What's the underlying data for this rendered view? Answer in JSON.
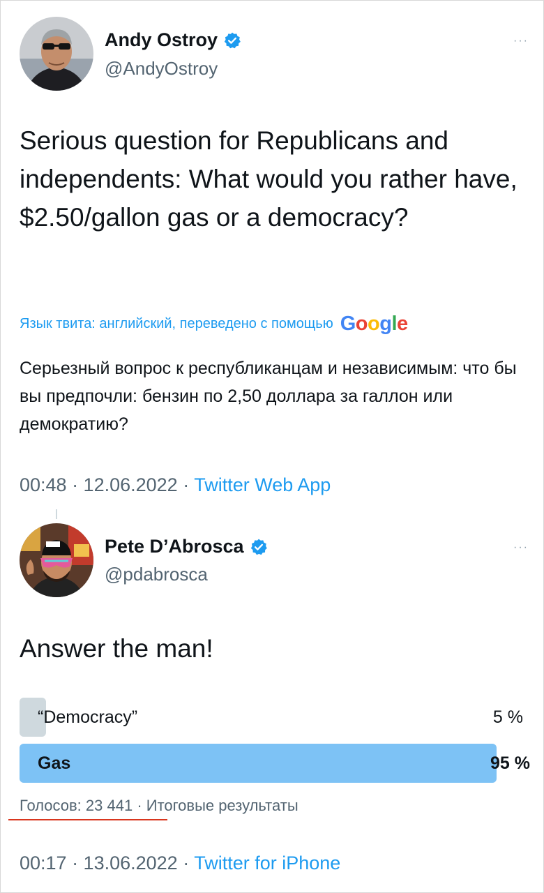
{
  "tweet1": {
    "author_name": "Andy Ostroy",
    "author_handle": "@AndyOstroy",
    "more": "···",
    "text": "Serious question for Republicans and independents: What would you rather have, $2.50/gallon gas or a democracy?",
    "translation_note": "Язык твита: английский, переведено с помощью",
    "translation_brand": "Google",
    "translation_text": "Серьезный вопрос к республиканцам и независимым: что бы вы предпочли: бензин по 2,50 доллара за галлон или демократию?",
    "timestamp": "00:48 · 12.06.2022 · ",
    "source": "Twitter Web App"
  },
  "tweet2": {
    "author_name": "Pete D’Abrosca",
    "author_handle": "@pdabrosca",
    "more": "···",
    "text": "Answer the man!",
    "poll": {
      "options": [
        {
          "label": "“Democracy”",
          "percent_label": "5 %",
          "percent": 5,
          "winner": false
        },
        {
          "label": "Gas",
          "percent_label": "95 %",
          "percent": 95,
          "winner": true
        }
      ],
      "votes_text": "Голосов: 23 441",
      "status_text": " · Итоговые результаты"
    },
    "timestamp": "00:17 · 13.06.2022 · ",
    "source": "Twitter for iPhone"
  },
  "colors": {
    "accent": "#1d9bf0",
    "poll_winner": "#7dc2f5",
    "poll_loser": "#cfd9de",
    "underline": "#d9361e"
  },
  "icons": [
    "verified-badge-icon",
    "more-options-icon",
    "google-logo"
  ]
}
